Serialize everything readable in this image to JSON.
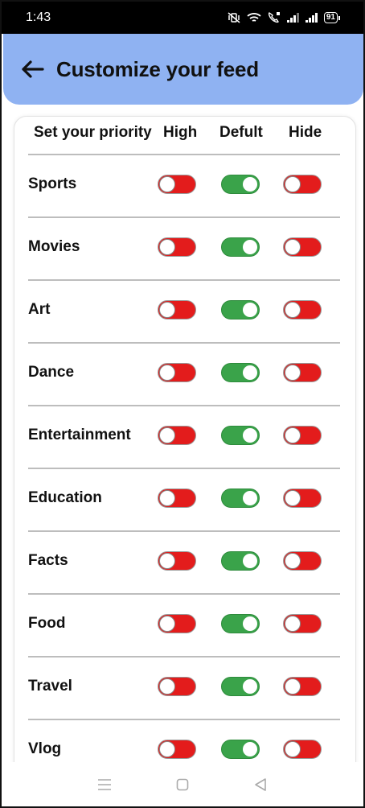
{
  "status_bar": {
    "time": "1:43",
    "battery": "91",
    "icons": [
      "mute-vibrate-icon",
      "wifi-icon",
      "volte-call-icon",
      "signal-icon",
      "signal-icon",
      "battery-icon"
    ]
  },
  "header": {
    "back_icon": "arrow-left-icon",
    "title": "Customize your feed",
    "background": "#8fb2f2"
  },
  "columns": {
    "priority_label": "Set your priority",
    "high": "High",
    "default": "Defult",
    "hide": "Hide"
  },
  "colors": {
    "toggle_on": "#3aa34a",
    "toggle_off": "#e31c1c"
  },
  "categories": [
    {
      "label": "Sports",
      "high": false,
      "default": true,
      "hide": false
    },
    {
      "label": "Movies",
      "high": false,
      "default": true,
      "hide": false
    },
    {
      "label": "Art",
      "high": false,
      "default": true,
      "hide": false
    },
    {
      "label": "Dance",
      "high": false,
      "default": true,
      "hide": false
    },
    {
      "label": "Entertainment",
      "high": false,
      "default": true,
      "hide": false
    },
    {
      "label": "Education",
      "high": false,
      "default": true,
      "hide": false
    },
    {
      "label": "Facts",
      "high": false,
      "default": true,
      "hide": false
    },
    {
      "label": "Food",
      "high": false,
      "default": true,
      "hide": false
    },
    {
      "label": "Travel",
      "high": false,
      "default": true,
      "hide": false
    },
    {
      "label": "Vlog",
      "high": false,
      "default": true,
      "hide": false
    }
  ],
  "nav_bar": {
    "icons": [
      "menu-icon",
      "home-square-icon",
      "back-triangle-icon"
    ]
  }
}
